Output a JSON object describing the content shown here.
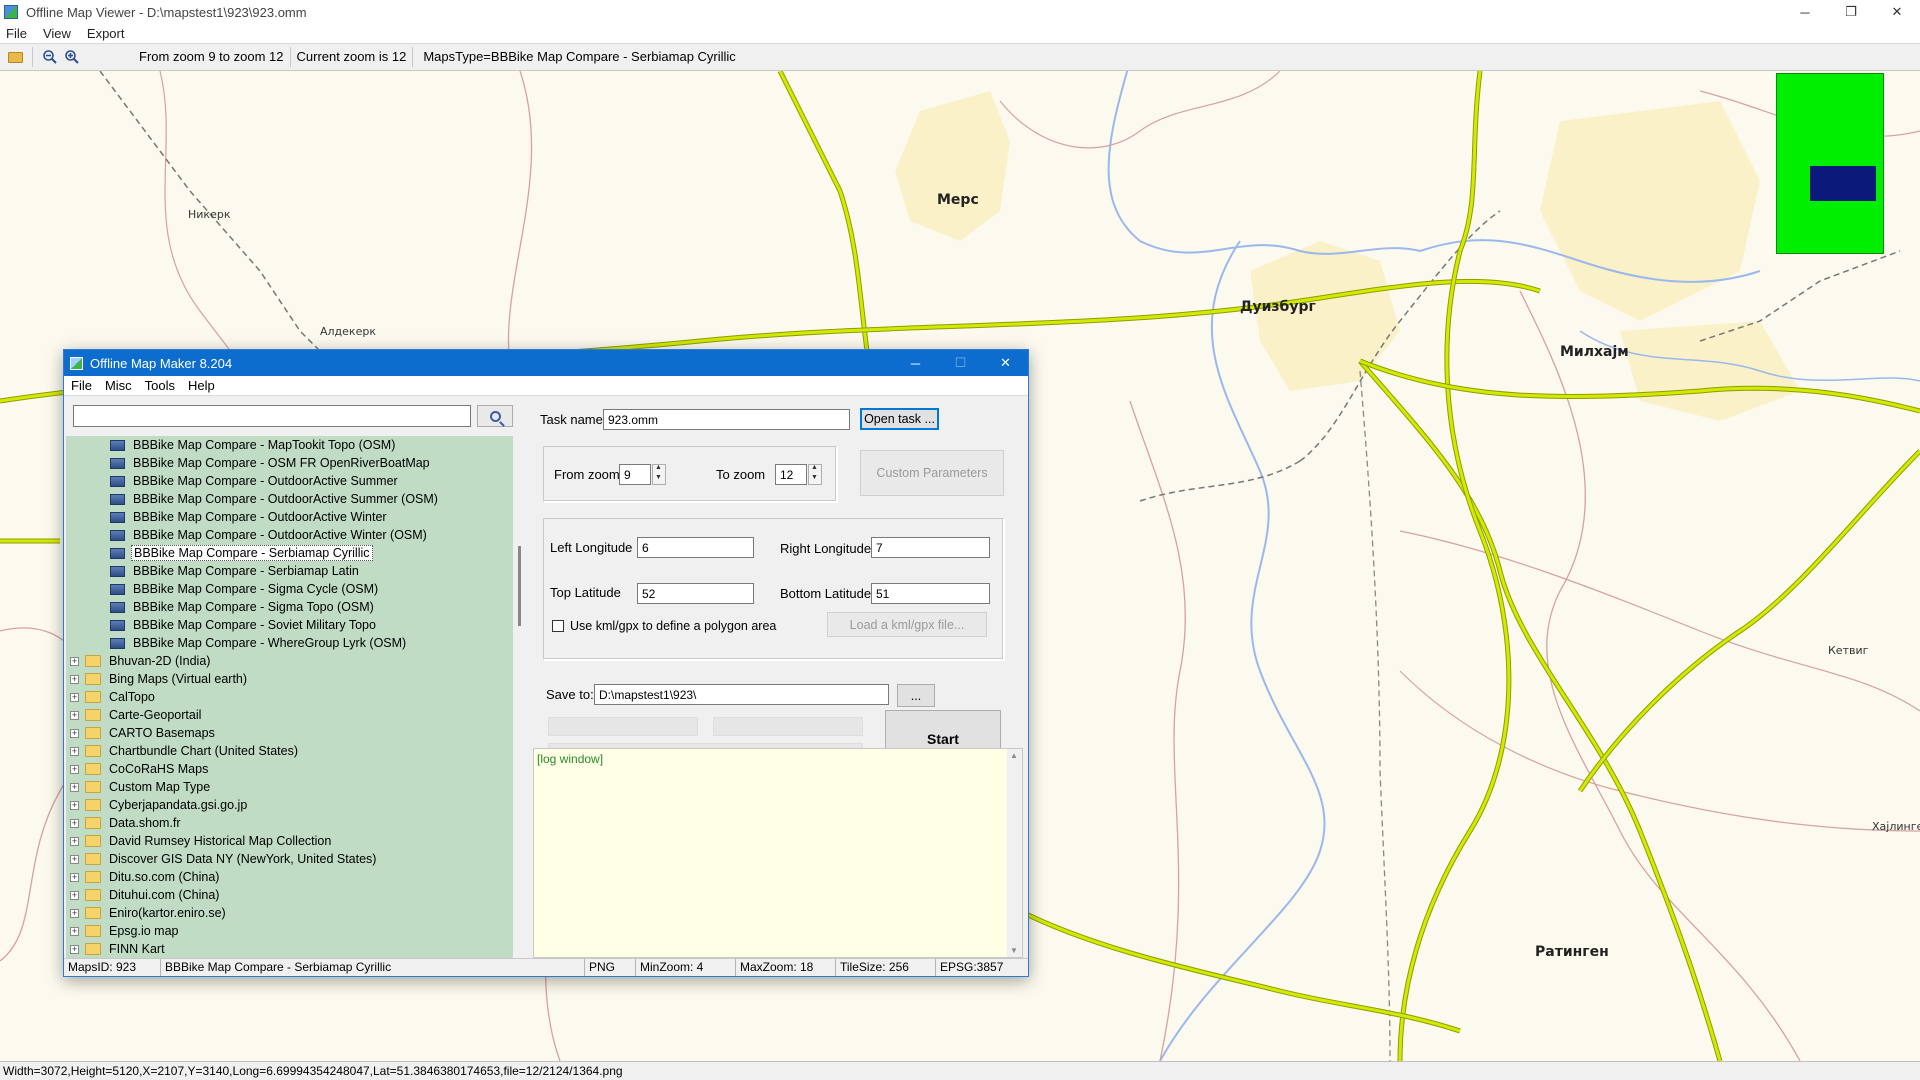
{
  "window": {
    "title": "Offline Map Viewer - D:\\mapstest1\\923\\923.omm",
    "controls": [
      "─",
      "❐",
      "✕"
    ]
  },
  "menu": [
    "File",
    "View",
    "Export"
  ],
  "toolbar": {
    "zoom_range": "From zoom 9 to zoom 12",
    "current_zoom": "Current zoom is 12",
    "maps_type": "MapsType=BBBike Map Compare - Serbiamap Cyrillic",
    "icons": [
      "open-folder-icon",
      "zoom-out-icon",
      "zoom-in-icon"
    ]
  },
  "map": {
    "cities": [
      "Мерс",
      "Дуизбург",
      "Милхајм",
      "Ратинген"
    ],
    "towns": [
      "Никерк",
      "Алдекерк",
      "Кетвиг",
      "Хајлинген"
    ],
    "colors": {
      "background": "#fcfaee",
      "motorway": "#c8dd00",
      "urban": "#faf1c8",
      "river": "#9ab8ee",
      "border": "#d8a0a0"
    }
  },
  "status_bar": "Width=3072,Height=5120,X=2107,Y=3140,Long=6.69994354248047,Lat=51.3846380174653,file=12/2124/1364.png",
  "dialog": {
    "title": "Offline Map Maker 8.204",
    "menu": [
      "File",
      "Misc",
      "Tools",
      "Help"
    ],
    "search": {
      "value": "",
      "placeholder": ""
    },
    "tree": {
      "children": [
        "BBBike Map Compare - MapTookit Topo (OSM)",
        "BBBike Map Compare - OSM FR OpenRiverBoatMap",
        "BBBike Map Compare - OutdoorActive Summer",
        "BBBike Map Compare - OutdoorActive Summer (OSM)",
        "BBBike Map Compare - OutdoorActive Winter",
        "BBBike Map Compare - OutdoorActive Winter (OSM)",
        "BBBike Map Compare - Serbiamap Cyrillic",
        "BBBike Map Compare - Serbiamap Latin",
        "BBBike Map Compare - Sigma Cycle (OSM)",
        "BBBike Map Compare - Sigma Topo (OSM)",
        "BBBike Map Compare - Soviet Military Topo",
        "BBBike Map Compare - WhereGroup Lyrk (OSM)"
      ],
      "selected_index": 6,
      "parents": [
        "Bhuvan-2D (India)",
        "Bing Maps (Virtual earth)",
        "CalTopo",
        "Carte-Geoportail",
        "CARTO Basemaps",
        "Chartbundle Chart (United States)",
        "CoCoRaHS Maps",
        "Custom Map Type",
        "Cyberjapandata.gsi.go.jp",
        "Data.shom.fr",
        "David Rumsey Historical Map Collection",
        "Discover GIS Data NY (NewYork, United States)",
        "Ditu.so.com (China)",
        "Dituhui.com (China)",
        "Eniro(kartor.eniro.se)",
        "Epsg.io map",
        "FINN Kart"
      ]
    },
    "task_name_label": "Task name",
    "task_name_value": "923.omm",
    "open_task_label": "Open task ...",
    "from_zoom_label": "From zoom",
    "from_zoom_value": "9",
    "to_zoom_label": "To zoom",
    "to_zoom_value": "12",
    "custom_params_label": "Custom Parameters",
    "left_lon_label": "Left Longitude",
    "left_lon_value": "6",
    "right_lon_label": "Right Longitude",
    "right_lon_value": "7",
    "top_lat_label": "Top Latitude",
    "top_lat_value": "52",
    "bottom_lat_label": "Bottom Latitude",
    "bottom_lat_value": "51",
    "polygon_checkbox_label": "Use kml/gpx to define a polygon area",
    "load_kml_label": "Load a kml/gpx file...",
    "save_to_label": "Save to:",
    "save_to_value": "D:\\mapstest1\\923\\",
    "browse_label": "...",
    "start_label": "Start",
    "log_text": "[log window]",
    "status": {
      "maps_id": "MapsID: 923",
      "map_name": "BBBike Map Compare - Serbiamap Cyrillic",
      "format": "PNG",
      "min_zoom": "MinZoom: 4",
      "max_zoom": "MaxZoom: 18",
      "tile_size": "TileSize: 256",
      "epsg": "EPSG:3857"
    }
  }
}
